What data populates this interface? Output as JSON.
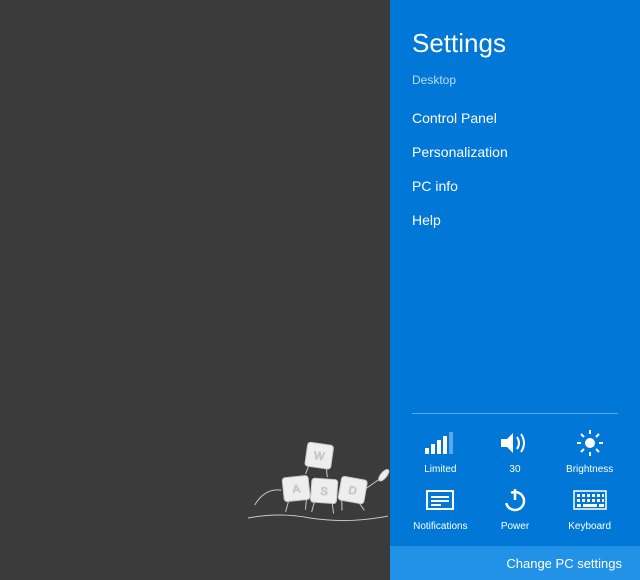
{
  "colors": {
    "desktop_bg": "#3b3b3b",
    "panel_bg": "#0178d7",
    "panel_footer_bg": "#2292e6",
    "panel_text": "#ffffff",
    "panel_subtitle": "#b9dcf5"
  },
  "desktop": {
    "wallpaper_motif": "wasd-keycaps-characters"
  },
  "settings_panel": {
    "title": "Settings",
    "subtitle": "Desktop",
    "links": [
      {
        "label": "Control Panel"
      },
      {
        "label": "Personalization"
      },
      {
        "label": "PC info"
      },
      {
        "label": "Help"
      }
    ],
    "tiles": [
      {
        "icon": "signal-bars-icon",
        "label": "Limited"
      },
      {
        "icon": "volume-icon",
        "label": "30"
      },
      {
        "icon": "brightness-icon",
        "label": "Brightness"
      },
      {
        "icon": "notifications-icon",
        "label": "Notifications"
      },
      {
        "icon": "power-icon",
        "label": "Power"
      },
      {
        "icon": "keyboard-icon",
        "label": "Keyboard"
      }
    ],
    "footer_link": "Change PC settings"
  }
}
